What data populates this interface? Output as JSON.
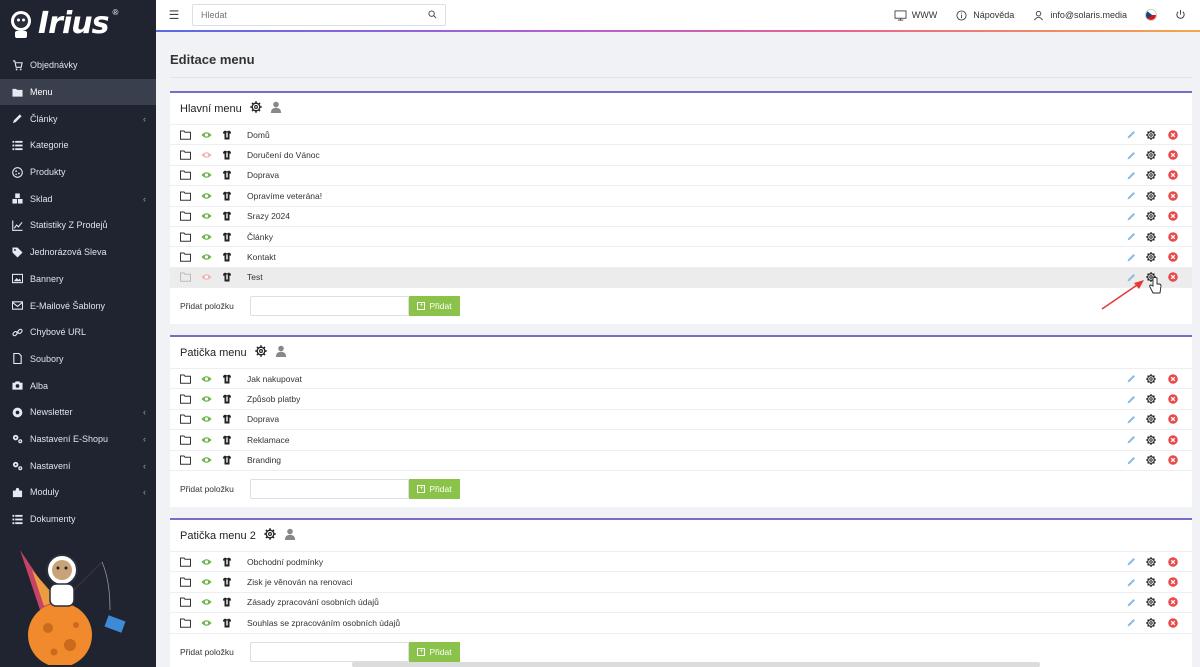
{
  "app": {
    "logo_text": "Irius",
    "logo_reg": "®"
  },
  "sidebar": {
    "items": [
      {
        "label": "Objednávky",
        "icon": "cart-icon",
        "chevron": false
      },
      {
        "label": "Menu",
        "icon": "folder-icon",
        "chevron": false,
        "active": true
      },
      {
        "label": "Články",
        "icon": "pencil-icon",
        "chevron": true
      },
      {
        "label": "Kategorie",
        "icon": "list-icon",
        "chevron": false
      },
      {
        "label": "Produkty",
        "icon": "cookie-icon",
        "chevron": false
      },
      {
        "label": "Sklad",
        "icon": "boxes-icon",
        "chevron": true
      },
      {
        "label": "Statistiky Z Prodejů",
        "icon": "chart-icon",
        "chevron": false
      },
      {
        "label": "Jednorázová Sleva",
        "icon": "tag-icon",
        "chevron": false
      },
      {
        "label": "Bannery",
        "icon": "image-icon",
        "chevron": false
      },
      {
        "label": "E-Mailové Šablony",
        "icon": "envelope-icon",
        "chevron": false
      },
      {
        "label": "Chybové URL",
        "icon": "link-icon",
        "chevron": false
      },
      {
        "label": "Soubory",
        "icon": "file-icon",
        "chevron": false
      },
      {
        "label": "Alba",
        "icon": "camera-icon",
        "chevron": false
      },
      {
        "label": "Newsletter",
        "icon": "at-icon",
        "chevron": true
      },
      {
        "label": "Nastavení E-Shopu",
        "icon": "cogs-icon",
        "chevron": true
      },
      {
        "label": "Nastavení",
        "icon": "cogs-icon",
        "chevron": true
      },
      {
        "label": "Moduly",
        "icon": "puzzle-icon",
        "chevron": true
      },
      {
        "label": "Dokumenty",
        "icon": "list-icon",
        "chevron": false
      }
    ]
  },
  "topbar": {
    "search_placeholder": "Hledat",
    "www_label": "WWW",
    "help_label": "Nápověda",
    "user_label": "info@solaris.media"
  },
  "page": {
    "title": "Editace menu"
  },
  "cards": [
    {
      "title": "Hlavní menu",
      "items": [
        {
          "label": "Domů",
          "visible": true
        },
        {
          "label": "Doručení do Vánoc",
          "visible": false
        },
        {
          "label": "Doprava",
          "visible": true
        },
        {
          "label": "Opravíme veterána!",
          "visible": true
        },
        {
          "label": "Srazy 2024",
          "visible": true
        },
        {
          "label": "Články",
          "visible": true
        },
        {
          "label": "Kontakt",
          "visible": true
        },
        {
          "label": "Test",
          "visible": false,
          "hover": true
        }
      ],
      "add_label": "Přidat položku",
      "add_button": "Přidat"
    },
    {
      "title": "Patička menu",
      "items": [
        {
          "label": "Jak nakupovat",
          "visible": true
        },
        {
          "label": "Způsob platby",
          "visible": true
        },
        {
          "label": "Doprava",
          "visible": true
        },
        {
          "label": "Reklamace",
          "visible": true
        },
        {
          "label": "Branding",
          "visible": true
        }
      ],
      "add_label": "Přidat položku",
      "add_button": "Přidat"
    },
    {
      "title": "Patička menu 2",
      "items": [
        {
          "label": "Obchodní podmínky",
          "visible": true
        },
        {
          "label": "Zisk je věnován na renovaci",
          "visible": true
        },
        {
          "label": "Zásady zpracování osobních údajů",
          "visible": true
        },
        {
          "label": "Souhlas se zpracováním osobních údajů",
          "visible": true
        }
      ],
      "add_label": "Přidat položku",
      "add_button": "Přidat"
    }
  ],
  "colors": {
    "sidebar_bg": "#1f2430",
    "accent_purple": "#7b6bc9",
    "add_button_green": "#8bc34a",
    "eye_green": "#6cb548",
    "eye_hidden": "#f2a9a9",
    "edit_blue": "#7fb3e5",
    "delete_red": "#e74c4c"
  }
}
